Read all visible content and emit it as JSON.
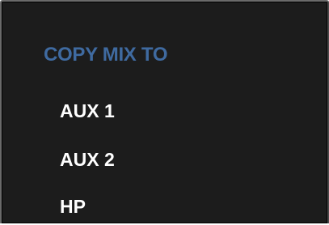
{
  "menu": {
    "header": "COPY MIX TO",
    "items": [
      {
        "label": "AUX 1"
      },
      {
        "label": "AUX 2"
      },
      {
        "label": "HP"
      }
    ]
  },
  "colors": {
    "background": "#1c1c1c",
    "header": "#3f6aa0",
    "item_text": "#ffffff",
    "border": "#6a6a6a"
  }
}
